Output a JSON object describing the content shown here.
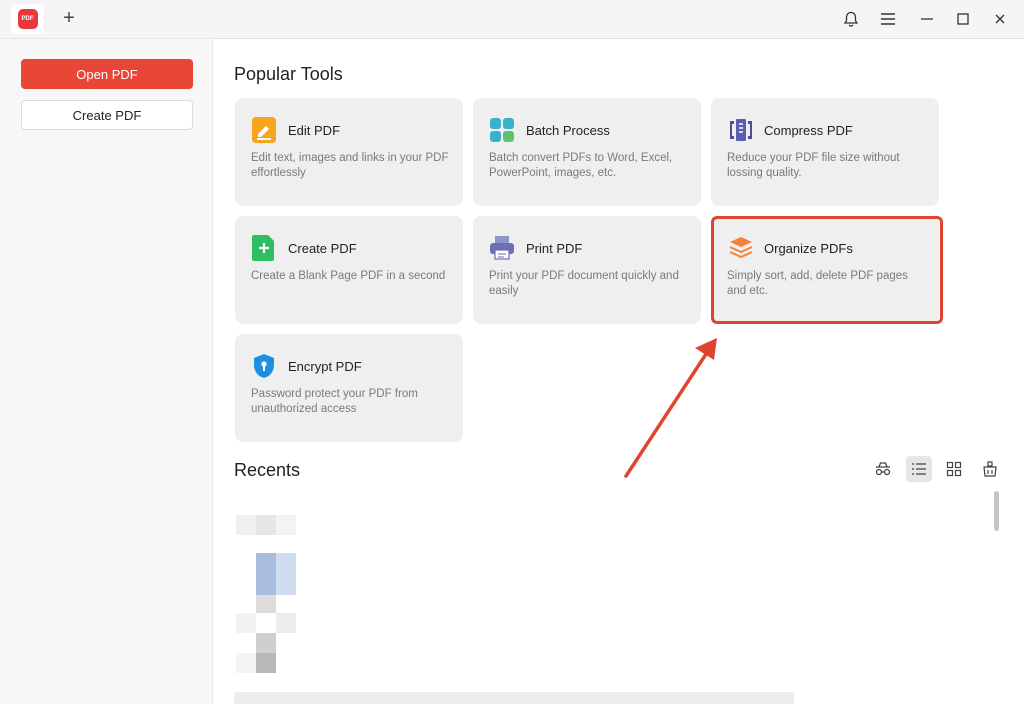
{
  "titlebar": {
    "logo_text": "PDF",
    "new_tab_icon": "plus-icon",
    "icons": [
      "bell-icon",
      "menu-icon",
      "minimize-icon",
      "maximize-icon",
      "close-icon"
    ]
  },
  "sidebar": {
    "open_label": "Open PDF",
    "create_label": "Create PDF"
  },
  "popular": {
    "title": "Popular Tools",
    "tools": [
      {
        "title": "Edit PDF",
        "desc": "Edit text, images and links in your PDF effortlessly",
        "icon": "edit-pdf-icon"
      },
      {
        "title": "Batch Process",
        "desc": "Batch convert PDFs to Word, Excel, PowerPoint, images, etc.",
        "icon": "batch-process-icon"
      },
      {
        "title": "Compress PDF",
        "desc": "Reduce your PDF file size without lossing quality.",
        "icon": "compress-pdf-icon"
      },
      {
        "title": "Create PDF",
        "desc": "Create a Blank Page PDF in a second",
        "icon": "create-pdf-icon"
      },
      {
        "title": "Print PDF",
        "desc": "Print your PDF document quickly and easily",
        "icon": "print-pdf-icon"
      },
      {
        "title": "Organize PDFs",
        "desc": "Simply sort, add, delete PDF pages and etc.",
        "icon": "organize-pdfs-icon"
      },
      {
        "title": "Encrypt PDF",
        "desc": "Password protect your PDF from unauthorized access",
        "icon": "encrypt-pdf-icon"
      }
    ]
  },
  "recents": {
    "title": "Recents",
    "view_icons": [
      "private-mode-icon",
      "list-view-icon",
      "grid-view-icon",
      "clean-icon"
    ]
  },
  "colors": {
    "accent": "#e84637",
    "highlight": "#e0442f",
    "card_bg": "#efefef"
  }
}
